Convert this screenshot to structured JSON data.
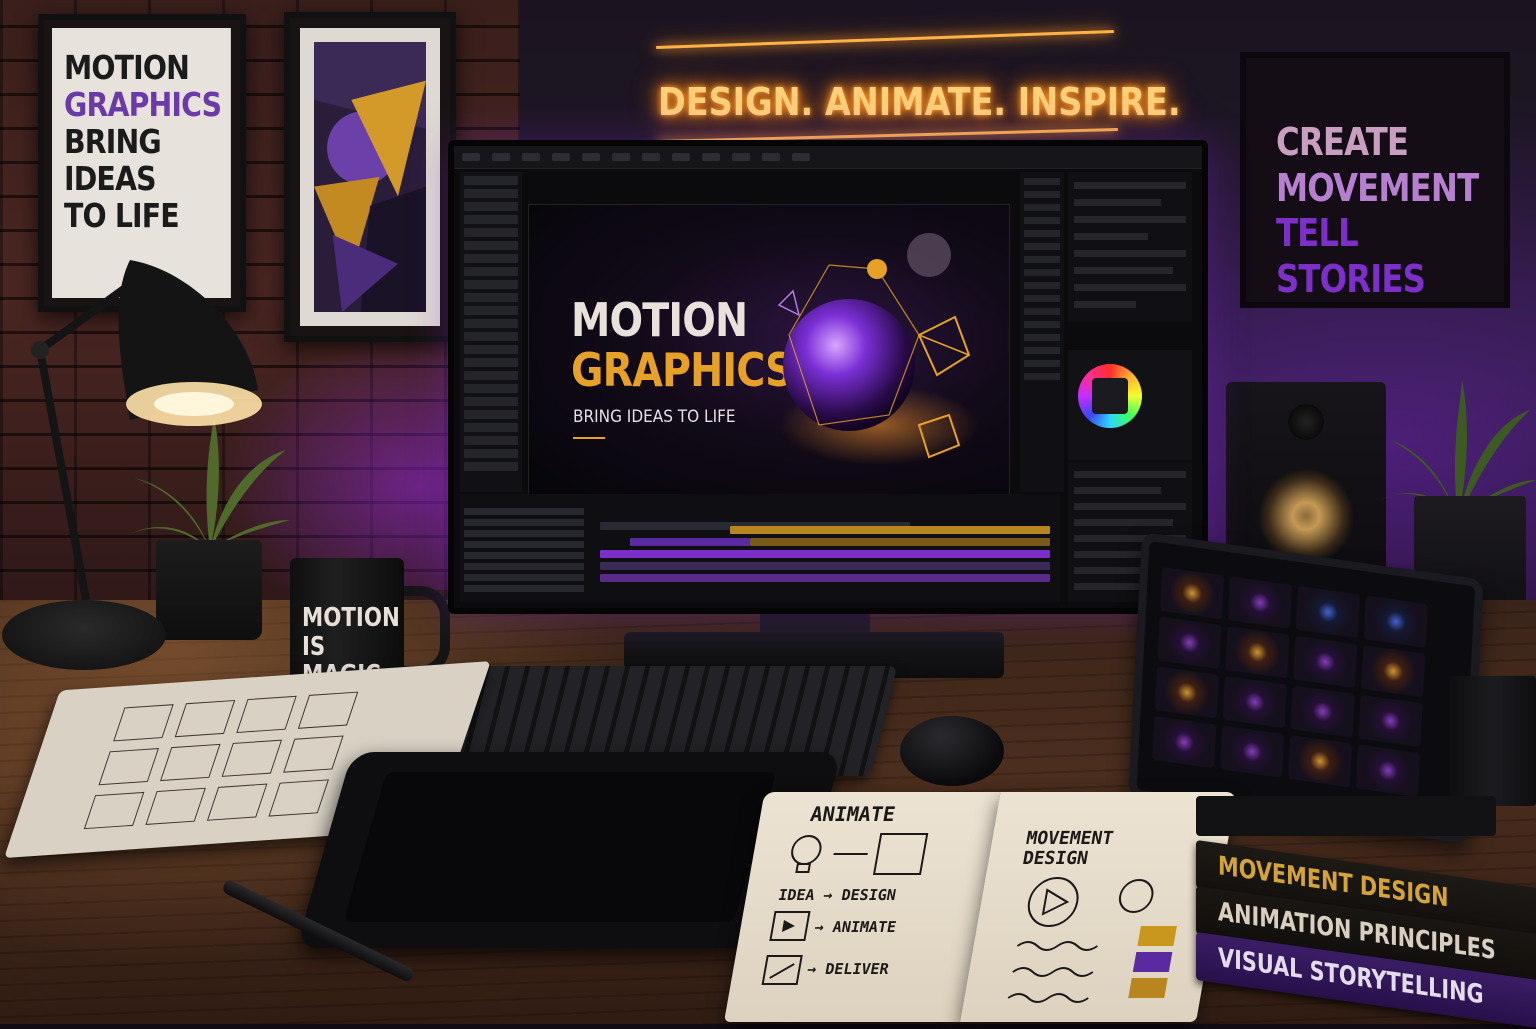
{
  "wall": {
    "poster_left": {
      "line1": "MOTION",
      "line2": "GRAPHICS",
      "line3": "BRING IDEAS",
      "line4": "TO LIFE"
    },
    "neon_sign": "DESIGN. ANIMATE. INSPIRE.",
    "poster_right": {
      "line1": "CREATE",
      "line2": "MOVEMENT",
      "line3": "TELL STORIES"
    }
  },
  "monitor": {
    "canvas": {
      "title_line1": "MOTION",
      "title_line2": "GRAPHICS",
      "tagline": "BRING IDEAS TO LIFE"
    }
  },
  "mug": {
    "line1": "MOTION",
    "line2": "IS MAGIC"
  },
  "open_book": {
    "left_page": {
      "heading": "ANIMATE",
      "step1": "IDEA → DESIGN",
      "step2": "→ ANIMATE",
      "step3": "→ DELIVER"
    },
    "right_page": {
      "heading_line1": "MOVEMENT",
      "heading_line2": "DESIGN"
    }
  },
  "book_stack": [
    "MOVEMENT DESIGN",
    "ANIMATION PRINCIPLES",
    "VISUAL STORYTELLING"
  ],
  "colors": {
    "accent_gold": "#e6a126",
    "accent_purple": "#7d2fc9",
    "neon_orange": "#ffcf7a"
  }
}
